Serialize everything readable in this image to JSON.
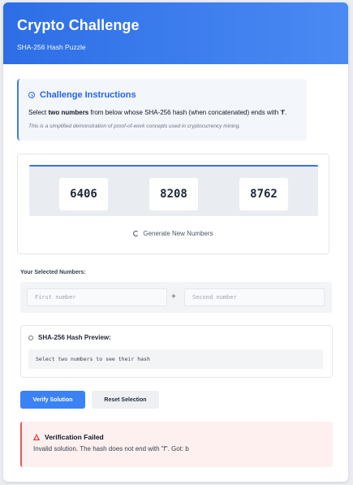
{
  "header": {
    "title": "Crypto Challenge",
    "subtitle": "SHA-256 Hash Puzzle"
  },
  "instructions": {
    "title": "Challenge Instructions",
    "text_prefix": "Select ",
    "text_bold": "two numbers",
    "text_middle": " from below whose SHA-256 hash (when concatenated) ends with '",
    "text_target": "f",
    "text_suffix": "'.",
    "note": "This is a simplified demonstration of proof-of-work concepts used in cryptocurrency mining."
  },
  "numbers": [
    "6406",
    "8208",
    "8762"
  ],
  "generate_label": "Generate New Numbers",
  "selection": {
    "label": "Your Selected Numbers:",
    "first_placeholder": "First number",
    "second_placeholder": "Second number",
    "first_value": "",
    "second_value": "",
    "operator": "+"
  },
  "hash": {
    "title": "SHA-256 Hash Preview:",
    "preview_text": "Select two numbers to see their hash"
  },
  "buttons": {
    "verify": "Verify Solution",
    "reset": "Reset Selection"
  },
  "result": {
    "title": "Verification Failed",
    "message": "Invalid solution. The hash does not end with \"f\". Got: b"
  },
  "colors": {
    "accent": "#3b82f6",
    "header_gradient_start": "#2d6ee6",
    "header_gradient_end": "#4a8af4",
    "error": "#dc2626",
    "error_bg": "#fdf0ef"
  }
}
